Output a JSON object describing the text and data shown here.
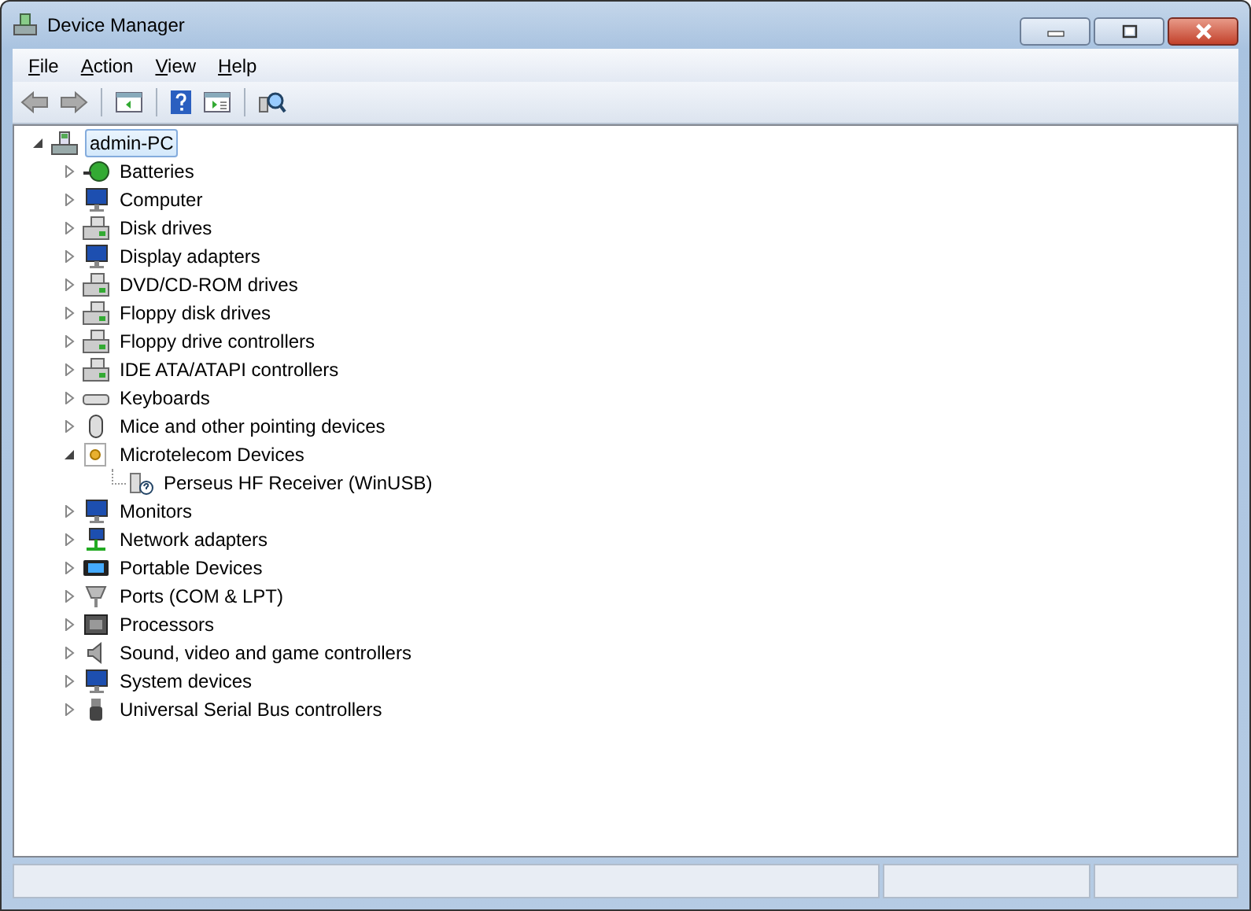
{
  "window": {
    "title": "Device Manager"
  },
  "menu": [
    {
      "label": "File"
    },
    {
      "label": "Action"
    },
    {
      "label": "View"
    },
    {
      "label": "Help"
    }
  ],
  "tree": {
    "label": "admin-PC",
    "expanded": true,
    "selected": true,
    "children": [
      {
        "label": "Batteries",
        "expanded": false
      },
      {
        "label": "Computer",
        "expanded": false
      },
      {
        "label": "Disk drives",
        "expanded": false
      },
      {
        "label": "Display adapters",
        "expanded": false
      },
      {
        "label": "DVD/CD-ROM drives",
        "expanded": false
      },
      {
        "label": "Floppy disk drives",
        "expanded": false
      },
      {
        "label": "Floppy drive controllers",
        "expanded": false
      },
      {
        "label": "IDE ATA/ATAPI controllers",
        "expanded": false
      },
      {
        "label": "Keyboards",
        "expanded": false
      },
      {
        "label": "Mice and other pointing devices",
        "expanded": false
      },
      {
        "label": "Microtelecom Devices",
        "expanded": true,
        "children": [
          {
            "label": "Perseus HF Receiver (WinUSB)"
          }
        ]
      },
      {
        "label": "Monitors",
        "expanded": false
      },
      {
        "label": "Network adapters",
        "expanded": false
      },
      {
        "label": "Portable Devices",
        "expanded": false
      },
      {
        "label": "Ports (COM & LPT)",
        "expanded": false
      },
      {
        "label": "Processors",
        "expanded": false
      },
      {
        "label": "Sound, video and game controllers",
        "expanded": false
      },
      {
        "label": "System devices",
        "expanded": false
      },
      {
        "label": "Universal Serial Bus controllers",
        "expanded": false
      }
    ]
  }
}
